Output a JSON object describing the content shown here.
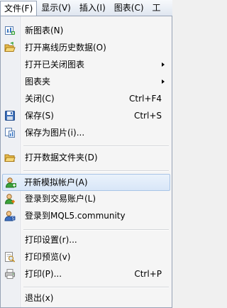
{
  "menubar": {
    "items": [
      {
        "label": "文件(F)"
      },
      {
        "label": "显示(V)"
      },
      {
        "label": "插入(I)"
      },
      {
        "label": "图表(C)"
      },
      {
        "label": "工"
      }
    ]
  },
  "file_menu": {
    "items": [
      {
        "label": "新图表(N)",
        "shortcut": "",
        "icon": "new-chart-icon"
      },
      {
        "label": "打开离线历史数据(O)",
        "shortcut": "",
        "icon": "open-folder-icon"
      },
      {
        "label": "打开已关闭图表",
        "shortcut": "",
        "submenu": true
      },
      {
        "label": "图表夹",
        "shortcut": "",
        "submenu": true
      },
      {
        "label": "关闭(C)",
        "shortcut": "Ctrl+F4"
      },
      {
        "label": "保存(S)",
        "shortcut": "Ctrl+S",
        "icon": "save-icon"
      },
      {
        "label": "保存为图片(i)...",
        "shortcut": "",
        "icon": "save-as-picture-icon"
      },
      {
        "label": "打开数据文件夹(D)",
        "shortcut": "",
        "icon": "folder-icon"
      },
      {
        "label": "开新模拟帐户(A)",
        "shortcut": "",
        "icon": "new-demo-account-icon"
      },
      {
        "label": "登录到交易账户(L)",
        "shortcut": "",
        "icon": "login-trade-account-icon"
      },
      {
        "label": "登录到MQL5.community",
        "shortcut": "",
        "icon": "mql5-community-icon"
      },
      {
        "label": "打印设置(r)...",
        "shortcut": ""
      },
      {
        "label": "打印预览(v)",
        "shortcut": "",
        "icon": "print-preview-icon"
      },
      {
        "label": "打印(P)...",
        "shortcut": "Ctrl+P",
        "icon": "print-icon"
      },
      {
        "label": "退出(x)",
        "shortcut": ""
      }
    ]
  }
}
